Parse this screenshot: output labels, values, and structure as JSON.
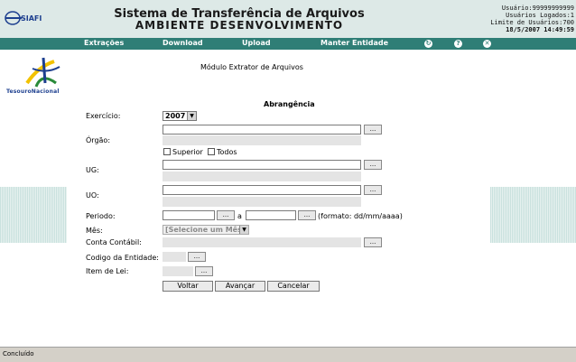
{
  "header": {
    "logo_text": "SIAFI",
    "title_line1": "Sistema de Transferência de Arquivos",
    "title_line2": "AMBIENTE DESENVOLVIMENTO",
    "user_label": "Usuário:99999999999",
    "logged_users": "Usuários Logados:1",
    "limit_users": "Limite de Usuários:700",
    "datetime": "18/5/2007 14:49:59"
  },
  "menu": {
    "items": [
      "Extrações",
      "Download",
      "Upload",
      "Manter Entidade"
    ],
    "icons": [
      "refresh-icon",
      "help-icon",
      "close-icon"
    ],
    "icon_glyphs": [
      "↻",
      "?",
      "✕"
    ],
    "bar_color": "#2f7e76"
  },
  "brand": {
    "tesouro": "TesouroNacional"
  },
  "module_title": "Módulo Extrator de Arquivos",
  "section_title": "Abrangência",
  "form": {
    "exercicio_label": "Exercício:",
    "exercicio_value": "2007",
    "orgao_label": "Órgão:",
    "superior_label": "Superior",
    "todos_label": "Todos",
    "ug_label": "UG:",
    "uo_label": "UO:",
    "periodo_label": "Periodo:",
    "periodo_sep": "a",
    "periodo_format": "(formato: dd/mm/aaaa)",
    "mes_label": "Mês:",
    "mes_value": "[Selecione um Mês]",
    "conta_label": "Conta Contábil:",
    "entidade_label": "Codigo da Entidade:",
    "item_lei_label": "Item de Lei:",
    "ellipsis": "...",
    "dropdown_arrow": "▼"
  },
  "buttons": {
    "voltar": "Voltar",
    "avancar": "Avançar",
    "cancelar": "Cancelar"
  },
  "status": {
    "text": "Concluído"
  }
}
